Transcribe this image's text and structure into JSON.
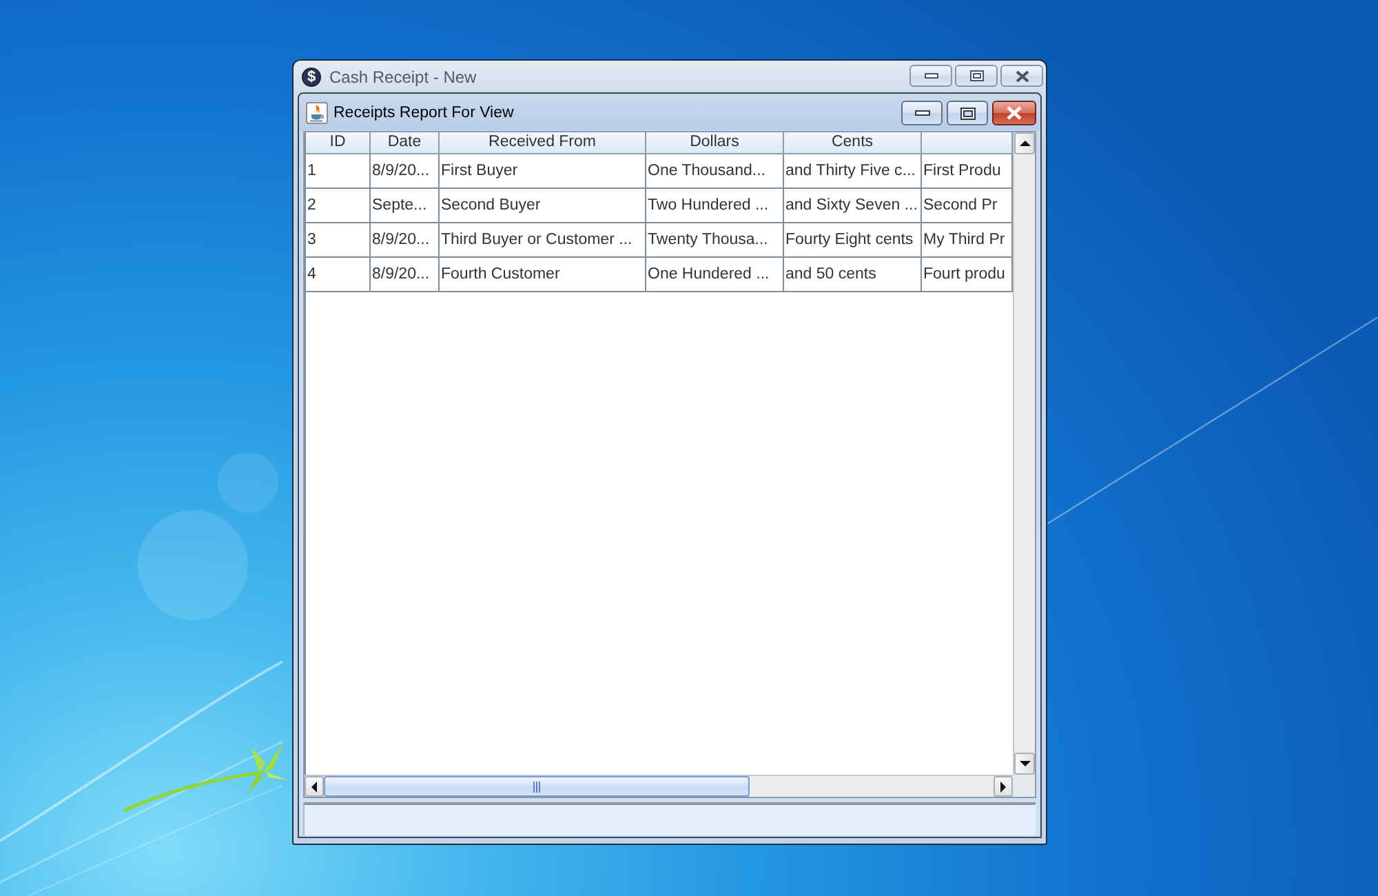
{
  "outer_window": {
    "icon_glyph": "$",
    "title": "Cash Receipt - New"
  },
  "report_window": {
    "title": "Receipts Report For View"
  },
  "table": {
    "columns": [
      "ID",
      "Date",
      "Received From",
      "Dollars",
      "Cents"
    ],
    "rows": [
      {
        "cells": [
          "1",
          "8/9/20...",
          "First Buyer",
          "One Thousand...",
          "and Thirty Five c...",
          "First Produ"
        ]
      },
      {
        "cells": [
          "2",
          "Septe...",
          "Second Buyer",
          "Two Hundered ...",
          "and Sixty Seven ...",
          "Second Pr"
        ]
      },
      {
        "cells": [
          "3",
          "8/9/20...",
          "Third Buyer or Customer ...",
          "Twenty Thousa...",
          "Fourty Eight cents",
          "My Third Pr"
        ]
      },
      {
        "cells": [
          "4",
          "8/9/20...",
          "Fourth Customer",
          "One Hundered ...",
          "and 50 cents",
          "Fourt produ"
        ]
      }
    ]
  }
}
